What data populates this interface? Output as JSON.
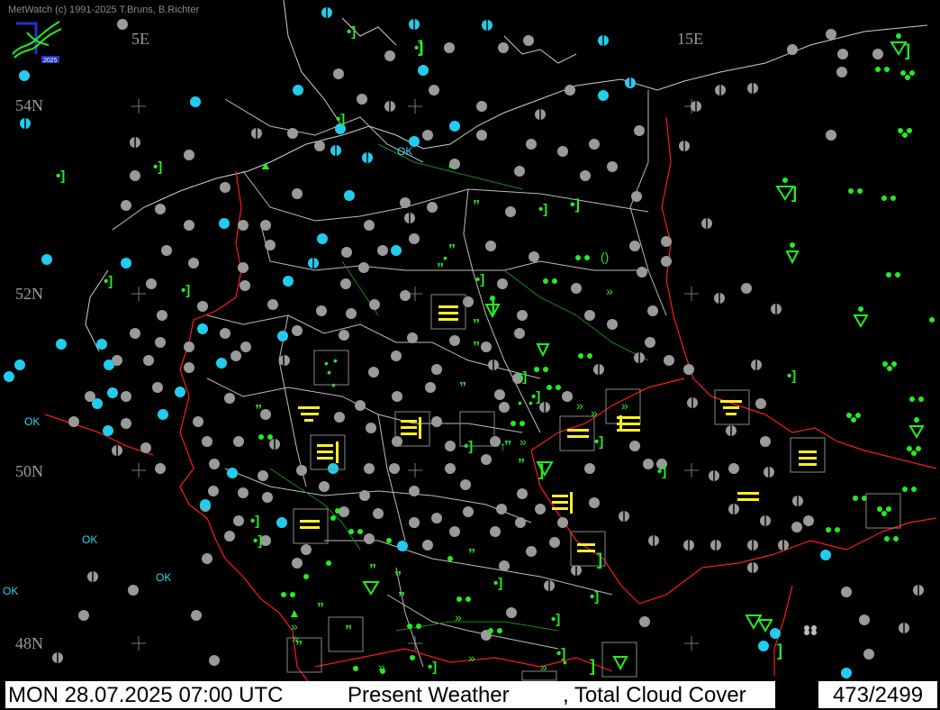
{
  "credit": "MetWatch  (c) 1991-2025 T.Bruns, B.Richter",
  "logo": {
    "text": "2025",
    "icon": "metwatch-logo-icon"
  },
  "grid_labels": {
    "lon_5": "5E",
    "lon_15": "15E",
    "lat_54": "54N",
    "lat_52": "52N",
    "lat_50": "50N",
    "lat_48": "48N"
  },
  "ok_marker": "OK",
  "status": {
    "datetime": "MON 28.07.2025 07:00 UTC",
    "layer1": "Present Weather",
    "layer2": ", Total Cloud Cover",
    "count": "473/2499"
  },
  "colors": {
    "background": "#000000",
    "border": "#ff1a1a",
    "state_line": "#cfcfcf",
    "river": "#1a8a1a",
    "cloud_gray": "#9a9a9a",
    "cloud_cyan": "#22ccee",
    "rain_green": "#22ee22",
    "fog_yellow": "#ffee22"
  },
  "legend_symbols": [
    "cloud-cover-circle",
    "drizzle-symbol",
    "rain-symbol",
    "shower-symbol",
    "fog-symbol",
    "thunderstorm-symbol"
  ]
}
